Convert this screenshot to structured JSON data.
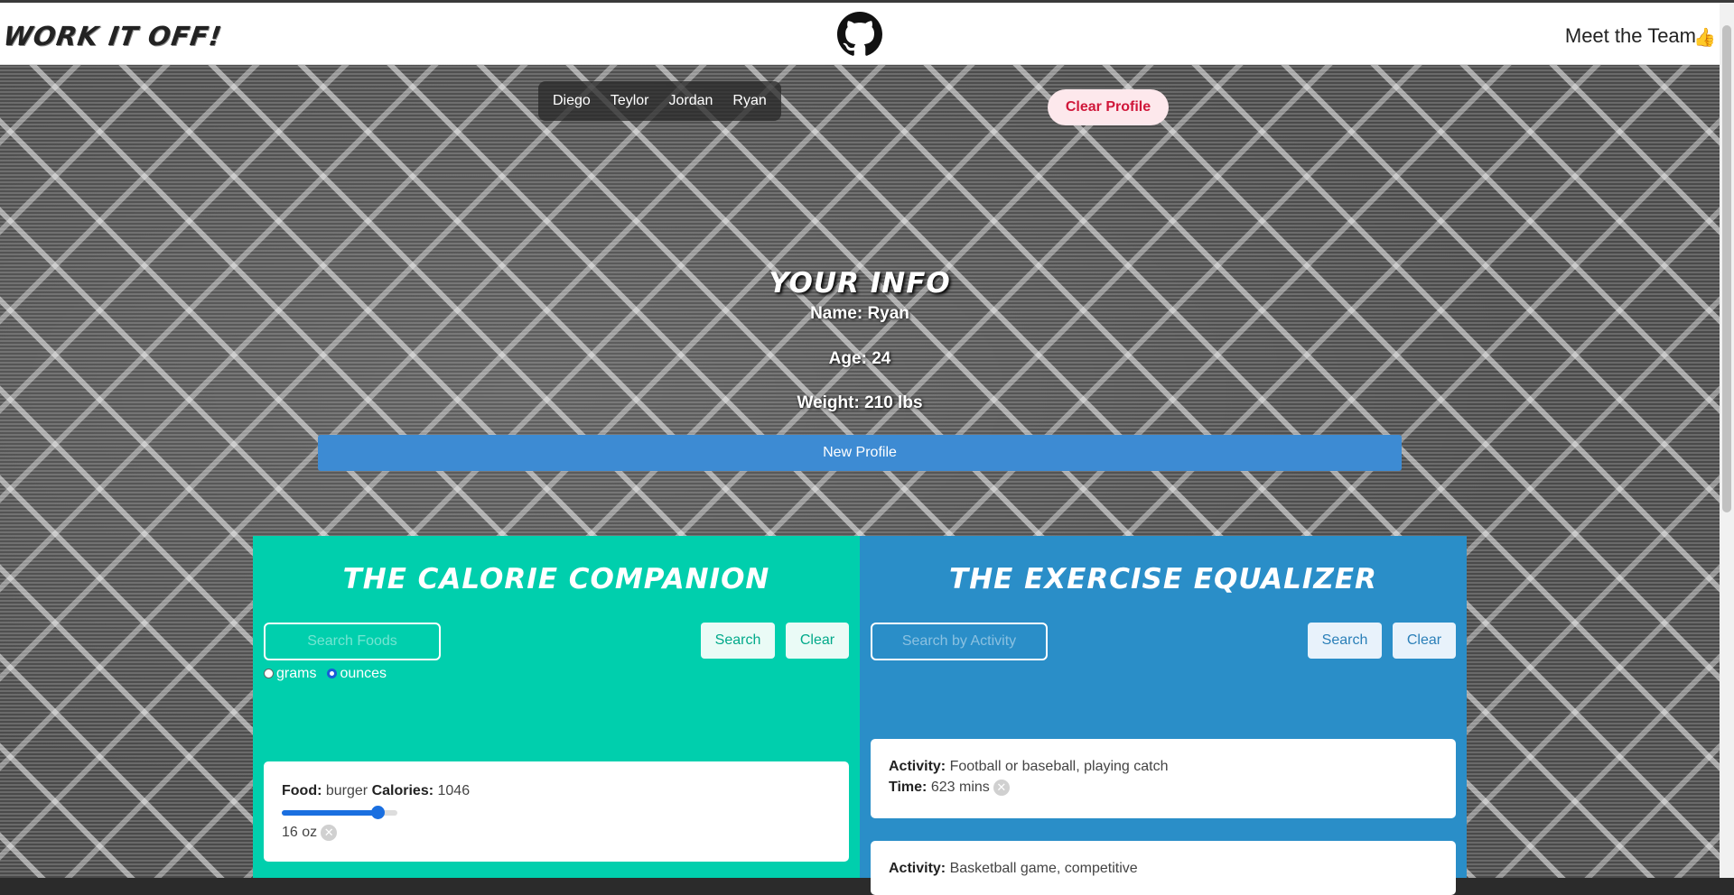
{
  "navbar": {
    "brand": "WORK IT OFF!",
    "meet_team": "Meet the Team"
  },
  "profiles": [
    "Diego",
    "Teylor",
    "Jordan",
    "Ryan"
  ],
  "clear_profile_label": "Clear Profile",
  "info": {
    "title": "YOUR INFO",
    "name_label": "Name:",
    "name": "Ryan",
    "age_label": "Age:",
    "age": "24",
    "weight_label": "Weight:",
    "weight": "210 lbs",
    "new_profile_label": "New Profile"
  },
  "calorie": {
    "title": "THE CALORIE COMPANION",
    "search_placeholder": "Search Foods",
    "search_label": "Search",
    "clear_label": "Clear",
    "unit_options": [
      "grams",
      "ounces"
    ],
    "selected_unit": "ounces",
    "entries": [
      {
        "food_label": "Food:",
        "food": "burger",
        "cal_label": "Calories:",
        "calories": "1046",
        "slider_fraction": 0.83,
        "amount": "16 oz"
      }
    ]
  },
  "exercise": {
    "title": "THE EXERCISE EQUALIZER",
    "search_placeholder": "Search by Activity",
    "search_label": "Search",
    "clear_label": "Clear",
    "entries": [
      {
        "activity_label": "Activity:",
        "activity": "Football or baseball, playing catch",
        "time_label": "Time:",
        "time": "623 mins"
      },
      {
        "activity_label": "Activity:",
        "activity": "Basketball game, competitive"
      }
    ]
  },
  "colors": {
    "calorie_panel": "#00cfad",
    "exercise_panel": "#2a8ec8",
    "new_profile": "#3d8bd3",
    "clear_profile_text": "#d0173a"
  },
  "icons": [
    "github-icon",
    "thumbs-up-icon",
    "remove-icon"
  ]
}
